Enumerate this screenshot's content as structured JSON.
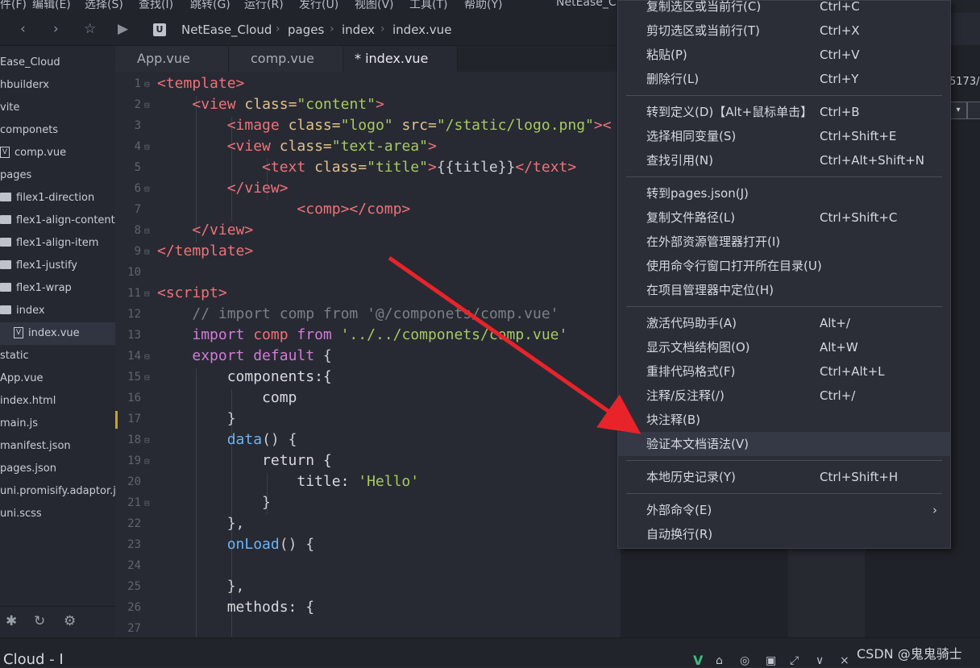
{
  "menubar": {
    "items": [
      "件(F)",
      "编辑(E)",
      "选择(S)",
      "查找(I)",
      "跳转(G)",
      "运行(R)",
      "发行(U)",
      "视图(V)",
      "工具(T)",
      "帮助(Y)"
    ],
    "window_title": "NetEase_C"
  },
  "nav": {
    "crumbs": [
      "NetEase_Cloud",
      "pages",
      "index",
      "index.vue"
    ]
  },
  "sidebar": {
    "items": [
      {
        "label": "Ease_Cloud",
        "type": "plain"
      },
      {
        "label": "hbuilderx",
        "type": "plain"
      },
      {
        "label": "vite",
        "type": "plain"
      },
      {
        "label": "componets",
        "type": "plain"
      },
      {
        "label": "comp.vue",
        "type": "file"
      },
      {
        "label": "pages",
        "type": "plain"
      },
      {
        "label": "filex1-direction",
        "type": "folder"
      },
      {
        "label": "flex1-align-content",
        "type": "folder"
      },
      {
        "label": "flex1-align-item",
        "type": "folder"
      },
      {
        "label": "flex1-justify",
        "type": "folder"
      },
      {
        "label": "flex1-wrap",
        "type": "folder"
      },
      {
        "label": "index",
        "type": "folder"
      },
      {
        "label": "index.vue",
        "type": "file",
        "selected": true
      },
      {
        "label": "static",
        "type": "plain"
      },
      {
        "label": "App.vue",
        "type": "plain"
      },
      {
        "label": "index.html",
        "type": "plain"
      },
      {
        "label": "main.js",
        "type": "plain"
      },
      {
        "label": "manifest.json",
        "type": "plain"
      },
      {
        "label": "pages.json",
        "type": "plain"
      },
      {
        "label": "uni.promisify.adaptor.js",
        "type": "plain"
      },
      {
        "label": "uni.scss",
        "type": "plain"
      }
    ]
  },
  "tabs": [
    {
      "label": "App.vue",
      "active": false
    },
    {
      "label": "comp.vue",
      "active": false
    },
    {
      "label": "* index.vue",
      "active": true
    }
  ],
  "editor": {
    "line_numbers": [
      "1",
      "2",
      "3",
      "4",
      "5",
      "6",
      "7",
      "8",
      "9",
      "10",
      "11",
      "12",
      "13",
      "14",
      "15",
      "16",
      "17",
      "18",
      "19",
      "20",
      "21",
      "22",
      "23",
      "24",
      "25",
      "26",
      "27"
    ],
    "lines": [
      [
        [
          "tag",
          "<template>"
        ]
      ],
      [
        [
          "plain",
          "    "
        ],
        [
          "tag",
          "<view "
        ],
        [
          "attr",
          "class="
        ],
        [
          "str",
          "\"content\""
        ],
        [
          "tag",
          ">"
        ]
      ],
      [
        [
          "plain",
          "        "
        ],
        [
          "tag",
          "<image "
        ],
        [
          "attr",
          "class="
        ],
        [
          "str",
          "\"logo\" "
        ],
        [
          "attr",
          "src="
        ],
        [
          "str",
          "\"/static/logo.png\""
        ],
        [
          "tag",
          "><"
        ]
      ],
      [
        [
          "plain",
          "        "
        ],
        [
          "tag",
          "<view "
        ],
        [
          "attr",
          "class="
        ],
        [
          "str",
          "\"text-area\""
        ],
        [
          "tag",
          ">"
        ]
      ],
      [
        [
          "plain",
          "            "
        ],
        [
          "tag",
          "<text "
        ],
        [
          "attr",
          "class="
        ],
        [
          "str",
          "\"title\""
        ],
        [
          "tag",
          ">"
        ],
        [
          "plain",
          "{{title}}"
        ],
        [
          "tag",
          "</text>"
        ]
      ],
      [
        [
          "plain",
          "        "
        ],
        [
          "tag",
          "</view>"
        ]
      ],
      [
        [
          "plain",
          "                "
        ],
        [
          "tag",
          "<comp></comp>"
        ]
      ],
      [
        [
          "plain",
          "    "
        ],
        [
          "tag",
          "</view>"
        ]
      ],
      [
        [
          "tag",
          "</template>"
        ]
      ],
      [
        [
          "plain",
          ""
        ]
      ],
      [
        [
          "tag",
          "<script>"
        ]
      ],
      [
        [
          "plain",
          "    "
        ],
        [
          "cmt",
          "// import comp from '@/componets/comp.vue'"
        ]
      ],
      [
        [
          "plain",
          "    "
        ],
        [
          "kw",
          "import "
        ],
        [
          "tag",
          "comp "
        ],
        [
          "kw",
          "from "
        ],
        [
          "str",
          "'../../componets/comp.vue'"
        ]
      ],
      [
        [
          "plain",
          "    "
        ],
        [
          "kw",
          "export default "
        ],
        [
          "plain",
          "{"
        ]
      ],
      [
        [
          "plain",
          "        "
        ],
        [
          "prop",
          "components:{"
        ]
      ],
      [
        [
          "plain",
          "            "
        ],
        [
          "prop",
          "comp"
        ]
      ],
      [
        [
          "plain",
          "        "
        ],
        [
          "plain",
          "}"
        ]
      ],
      [
        [
          "plain",
          "        "
        ],
        [
          "fn",
          "data"
        ],
        [
          "plain",
          "() {"
        ]
      ],
      [
        [
          "plain",
          "            "
        ],
        [
          "prop",
          "return {"
        ]
      ],
      [
        [
          "plain",
          "                "
        ],
        [
          "prop",
          "title: "
        ],
        [
          "str",
          "'Hello'"
        ]
      ],
      [
        [
          "plain",
          "            "
        ],
        [
          "plain",
          "}"
        ]
      ],
      [
        [
          "plain",
          "        "
        ],
        [
          "plain",
          "},"
        ]
      ],
      [
        [
          "plain",
          "        "
        ],
        [
          "fn",
          "onLoad"
        ],
        [
          "plain",
          "() {"
        ]
      ],
      [
        [
          "plain",
          ""
        ]
      ],
      [
        [
          "plain",
          "        "
        ],
        [
          "plain",
          "},"
        ]
      ],
      [
        [
          "plain",
          "        "
        ],
        [
          "prop",
          "methods: {"
        ]
      ],
      [
        [
          "plain",
          ""
        ]
      ]
    ]
  },
  "right_pane": {
    "url_fragment": "5173/#"
  },
  "context_menu": {
    "groups": [
      [
        {
          "label": "复制选区或当前行(C)",
          "shortcut": "Ctrl+C"
        },
        {
          "label": "剪切选区或当前行(T)",
          "shortcut": "Ctrl+X"
        },
        {
          "label": "粘贴(P)",
          "shortcut": "Ctrl+V"
        },
        {
          "label": "删除行(L)",
          "shortcut": "Ctrl+Y"
        }
      ],
      [
        {
          "label": "转到定义(D)【Alt+鼠标单击】",
          "shortcut": "Ctrl+B"
        },
        {
          "label": "选择相同变量(S)",
          "shortcut": "Ctrl+Shift+E"
        },
        {
          "label": "查找引用(N)",
          "shortcut": "Ctrl+Alt+Shift+N"
        }
      ],
      [
        {
          "label": "转到pages.json(J)",
          "shortcut": ""
        },
        {
          "label": "复制文件路径(L)",
          "shortcut": "Ctrl+Shift+C"
        },
        {
          "label": "在外部资源管理器打开(I)",
          "shortcut": ""
        },
        {
          "label": "使用命令行窗口打开所在目录(U)",
          "shortcut": ""
        },
        {
          "label": "在项目管理器中定位(H)",
          "shortcut": ""
        }
      ],
      [
        {
          "label": "激活代码助手(A)",
          "shortcut": "Alt+/"
        },
        {
          "label": "显示文档结构图(O)",
          "shortcut": "Alt+W"
        },
        {
          "label": "重排代码格式(F)",
          "shortcut": "Ctrl+Alt+L"
        },
        {
          "label": "注释/反注释(/)",
          "shortcut": "Ctrl+/"
        },
        {
          "label": "块注释(B)",
          "shortcut": ""
        },
        {
          "label": "验证本文档语法(V)",
          "shortcut": "",
          "highlighted": true
        }
      ],
      [
        {
          "label": "本地历史记录(Y)",
          "shortcut": "Ctrl+Shift+H"
        }
      ],
      [
        {
          "label": "外部命令(E)",
          "shortcut": "",
          "submenu": true
        },
        {
          "label": "自动换行(R)",
          "shortcut": ""
        }
      ]
    ]
  },
  "statusbar": {
    "title": "Cloud - I",
    "v_badge": "V"
  },
  "watermark": "CSDN @鬼鬼骑士",
  "colors": {
    "arrow": "#e8232a",
    "accent_green": "#3fbf7f",
    "modified_marker": "#c9a227"
  }
}
